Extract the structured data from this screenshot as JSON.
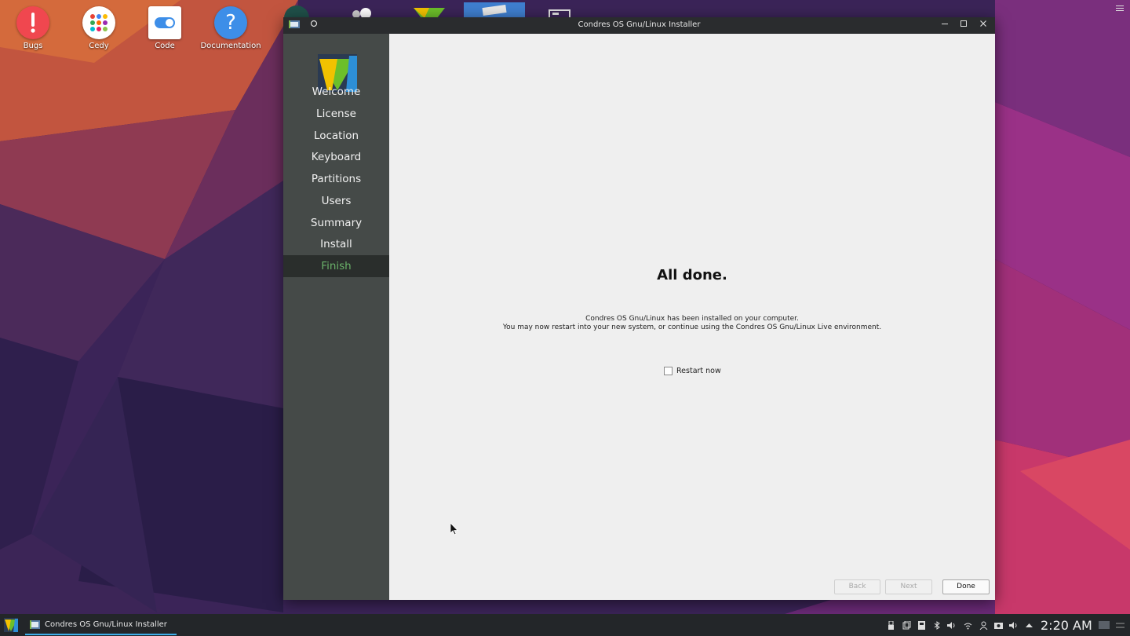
{
  "desktop": {
    "icons": [
      {
        "label": "Bugs",
        "icon": "exclamation-icon",
        "color": "#f0474f"
      },
      {
        "label": "Cedy",
        "icon": "app-grid-icon",
        "color": "#ffffff"
      },
      {
        "label": "Code",
        "icon": "toggle-switch-icon",
        "color": "#ffffff"
      },
      {
        "label": "Documentation",
        "icon": "question-mark-icon",
        "color": "#3d8ee8"
      }
    ]
  },
  "window": {
    "title": "Condres OS Gnu/Linux Installer",
    "sidebar": {
      "items": [
        {
          "label": "Welcome"
        },
        {
          "label": "License"
        },
        {
          "label": "Location"
        },
        {
          "label": "Keyboard"
        },
        {
          "label": "Partitions"
        },
        {
          "label": "Users"
        },
        {
          "label": "Summary"
        },
        {
          "label": "Install"
        },
        {
          "label": "Finish",
          "active": true
        }
      ],
      "active_color": "#6ab26a"
    },
    "content": {
      "heading": "All done.",
      "line1": "Condres OS Gnu/Linux has been installed on your computer.",
      "line2": "You may now restart into your new system, or continue using the Condres OS Gnu/Linux Live environment.",
      "restart_label": "Restart now",
      "restart_checked": false
    },
    "buttons": {
      "back": "Back",
      "next": "Next",
      "done": "Done"
    }
  },
  "taskbar": {
    "task_label": "Condres OS Gnu/Linux Installer",
    "clock": "2:20 AM",
    "accent": "#3daee9"
  }
}
